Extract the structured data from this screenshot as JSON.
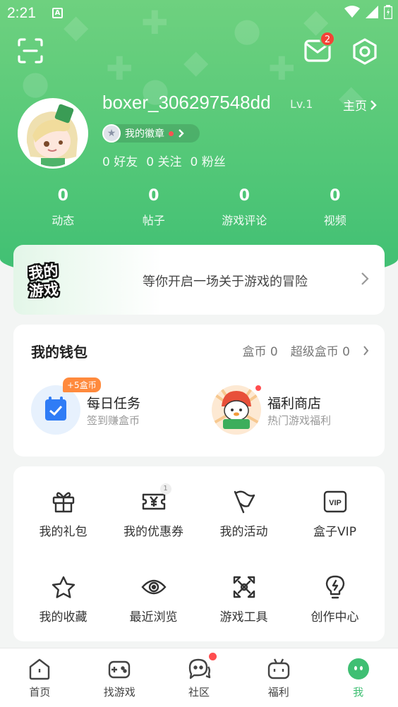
{
  "statusbar": {
    "time": "2:21",
    "a_icon": "A"
  },
  "header": {
    "message_badge": "2"
  },
  "profile": {
    "username": "boxer_306297548dd",
    "level": "Lv.1",
    "homepage_label": "主页",
    "medal_label": "我的徽章",
    "friends": "0 好友",
    "following": "0 关注",
    "fans": "0 粉丝",
    "stats": [
      {
        "value": "0",
        "label": "动态"
      },
      {
        "value": "0",
        "label": "帖子"
      },
      {
        "value": "0",
        "label": "游戏评论"
      },
      {
        "value": "0",
        "label": "视频"
      }
    ]
  },
  "my_games": {
    "logo_line1": "我的",
    "logo_line2": "游戏",
    "text": "等你开启一场关于游戏的冒险"
  },
  "wallet": {
    "title": "我的钱包",
    "coins": "盒币 0",
    "super_coins": "超级盒币 0",
    "daily": {
      "title": "每日任务",
      "subtitle": "签到赚盒币",
      "badge": "+5盒币"
    },
    "shop": {
      "title": "福利商店",
      "subtitle": "热门游戏福利"
    }
  },
  "grid": [
    {
      "label": "我的礼包",
      "icon": "gift-icon"
    },
    {
      "label": "我的优惠券",
      "icon": "coupon-icon",
      "badge": "1"
    },
    {
      "label": "我的活动",
      "icon": "flag-icon"
    },
    {
      "label": "盒子VIP",
      "icon": "vip-icon"
    },
    {
      "label": "我的收藏",
      "icon": "star-icon"
    },
    {
      "label": "最近浏览",
      "icon": "eye-icon"
    },
    {
      "label": "游戏工具",
      "icon": "tools-icon"
    },
    {
      "label": "创作中心",
      "icon": "bulb-icon"
    }
  ],
  "tabs": [
    {
      "label": "首页",
      "icon": "home-icon"
    },
    {
      "label": "找游戏",
      "icon": "gamepad-icon"
    },
    {
      "label": "社区",
      "icon": "chat-icon"
    },
    {
      "label": "福利",
      "icon": "gift-box-icon"
    },
    {
      "label": "我",
      "icon": "me-icon"
    }
  ],
  "colors": {
    "primary": "#3fbf73",
    "badge_red": "#f44336",
    "coin_orange": "#ff8a3d"
  }
}
